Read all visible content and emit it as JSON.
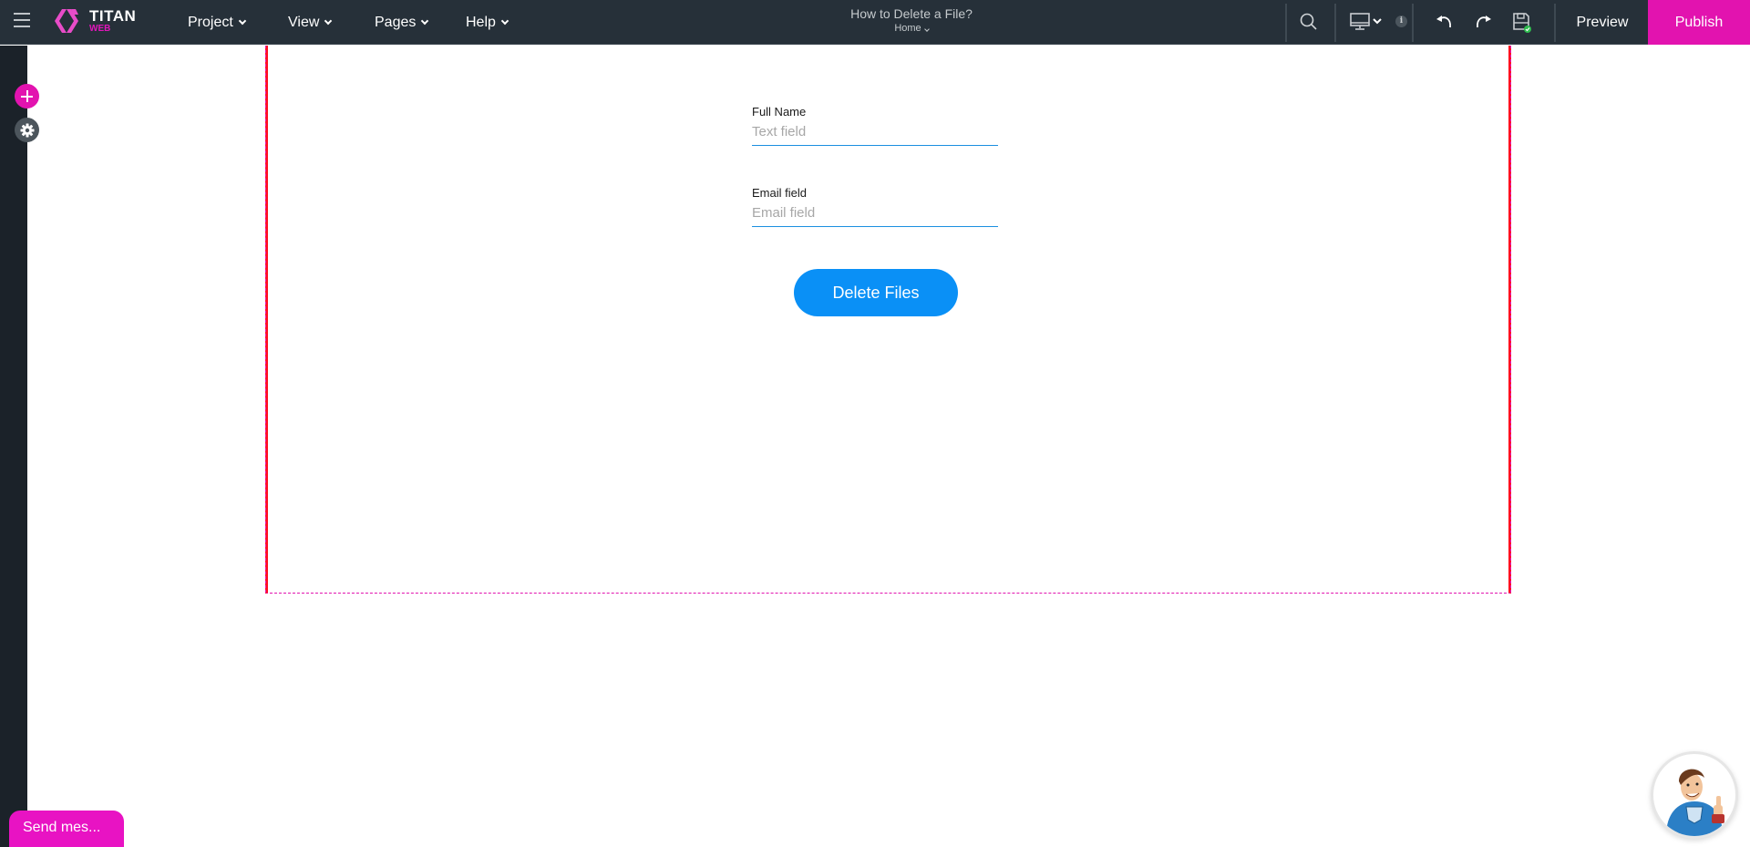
{
  "app": {
    "brand": "TITAN",
    "brand_sub": "WEB",
    "colors": {
      "topbar": "#263039",
      "accent": "#e213af",
      "button": "#0a90f6",
      "frame": "#ff1122"
    }
  },
  "topbar": {
    "menus": [
      {
        "label": "Project"
      },
      {
        "label": "View"
      },
      {
        "label": "Pages"
      },
      {
        "label": "Help"
      }
    ],
    "project_title": "How to Delete a File?",
    "current_page": "Home",
    "icons": [
      "search-icon",
      "desktop-icon",
      "info-icon",
      "undo-icon",
      "redo-icon",
      "save-icon"
    ],
    "info_glyph": "i",
    "preview_label": "Preview",
    "publish_label": "Publish"
  },
  "form": {
    "full_name": {
      "label": "Full Name",
      "placeholder": "Text field",
      "value": ""
    },
    "email": {
      "label": "Email field",
      "placeholder": "Email field",
      "value": ""
    },
    "submit_label": "Delete Files"
  },
  "chat": {
    "send_label": "Send mes..."
  }
}
